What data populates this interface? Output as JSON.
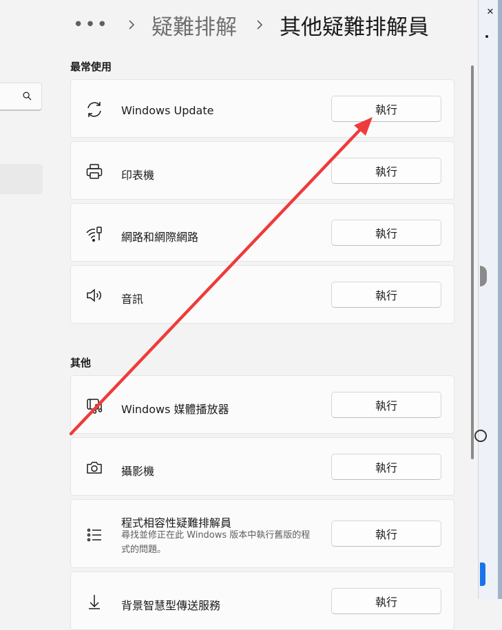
{
  "breadcrumb": {
    "more": "•••",
    "items": [
      "疑難排解",
      "其他疑難排解員"
    ]
  },
  "sections": [
    {
      "title": "最常使用",
      "items": [
        {
          "icon": "sync-icon",
          "title": "Windows Update",
          "button": "執行"
        },
        {
          "icon": "printer-icon",
          "title": "印表機",
          "button": "執行"
        },
        {
          "icon": "network-icon",
          "title": "網路和網際網路",
          "button": "執行"
        },
        {
          "icon": "speaker-icon",
          "title": "音訊",
          "button": "執行"
        }
      ]
    },
    {
      "title": "其他",
      "items": [
        {
          "icon": "media-player-icon",
          "title": "Windows 媒體播放器",
          "button": "執行"
        },
        {
          "icon": "camera-icon",
          "title": "攝影機",
          "button": "執行"
        },
        {
          "icon": "list-icon",
          "title": "程式相容性疑難排解員",
          "description": "尋找並修正在此 Windows 版本中執行舊版的程式的問題。",
          "button": "執行"
        },
        {
          "icon": "arrow-icon",
          "title": "背景智慧型傳送服務",
          "button": "執行"
        }
      ]
    }
  ],
  "right_window": {
    "close": "✕"
  },
  "colors": {
    "annotation_arrow": "#ef3b3b",
    "accent": "#1a73e8"
  }
}
